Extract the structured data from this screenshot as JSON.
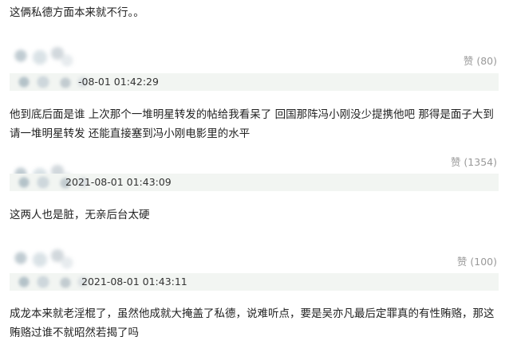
{
  "comments": [
    {
      "text": "这俩私德方面本来就不行。。"
    },
    {
      "likes": "赞 (80)",
      "timestamp": "-08-01 01:42:29",
      "text": "他到底后面是谁 上次那个一堆明星转发的帖给我看呆了 回国那阵冯小刚没少提携他吧 那得是面子大到请一堆明星转发 还能直接塞到冯小刚电影里的水平"
    },
    {
      "likes": "赞 (1354)",
      "timestamp": "2021-08-01 01:43:09",
      "text": "这两人也是脏，无亲后台太硬"
    },
    {
      "likes": "赞 (100)",
      "timestamp": "2021-08-01 01:43:11",
      "text": "成龙本来就老淫棍了，虽然他成就大掩盖了私德，说难听点，要是吴亦凡最后定罪真的有性贿赂，那这贿赂过谁不就昭然若揭了吗"
    }
  ],
  "colors": {
    "meta_bar_bg": "#f2f5f2",
    "like_text": "#999999",
    "body_text": "#222222"
  }
}
